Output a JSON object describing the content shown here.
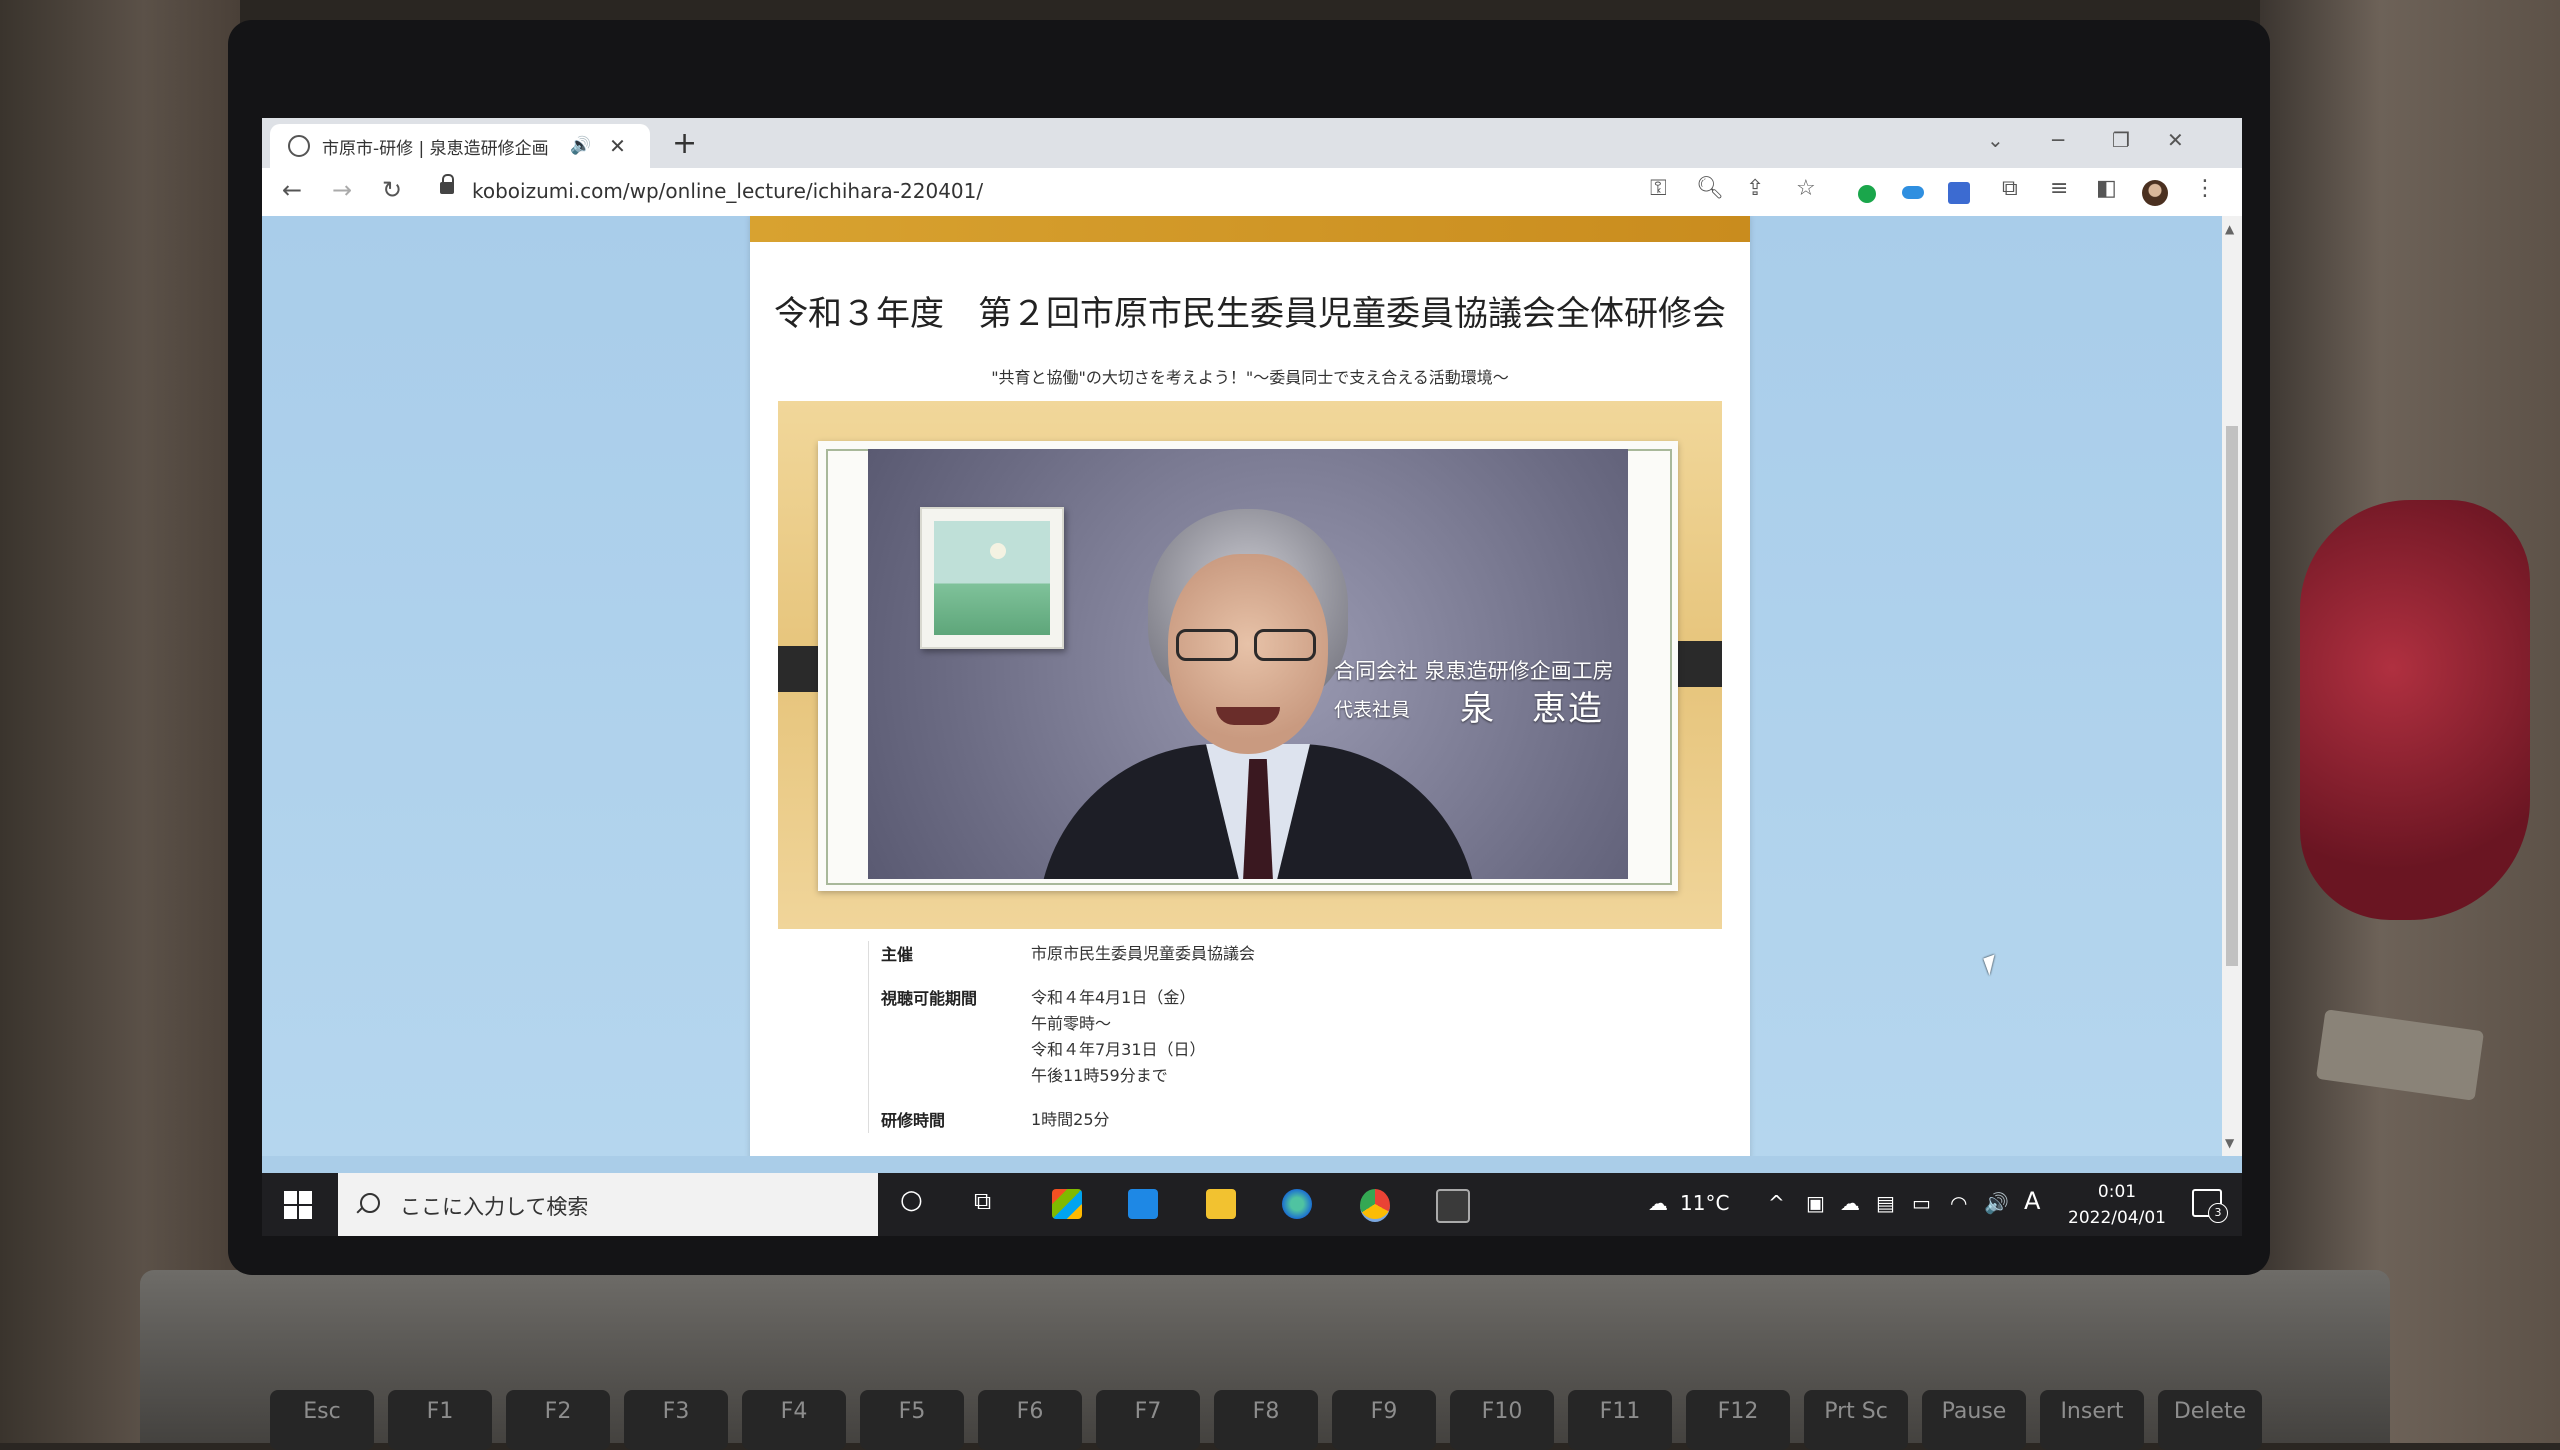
{
  "browser": {
    "tab_title": "市原市-研修 | 泉恵造研修企画",
    "new_tab": "+",
    "url": "koboizumi.com/wp/online_lecture/ichihara-220401/"
  },
  "page": {
    "heading": "令和３年度　第２回市原市民生委員児童委員協議会全体研修会",
    "subtitle": "\"共育と協働\"の大切さを考えよう！\"～委員同士で支え合える活動環境～",
    "video": {
      "company": "合同会社 泉恵造研修企画工房",
      "role": "代表社員",
      "name": "泉　恵造"
    },
    "info": [
      {
        "label": "主催",
        "lines": [
          "市原市民生委員児童委員協議会"
        ]
      },
      {
        "label": "視聴可能期間",
        "lines": [
          "令和４年4月1日（金）",
          "午前零時～",
          "令和４年7月31日（日）",
          "午後11時59分まで"
        ]
      },
      {
        "label": "研修時間",
        "lines": [
          "1時間25分"
        ]
      }
    ]
  },
  "taskbar": {
    "search_placeholder": "ここに入力して検索",
    "weather": "11°C",
    "ime": "A",
    "time": "0:01",
    "date": "2022/04/01",
    "notifications": "3"
  },
  "keyboard": [
    "Esc",
    "F1",
    "F2",
    "F3",
    "F4",
    "F5",
    "F6",
    "F7",
    "F8",
    "F9",
    "F10",
    "F11",
    "F12",
    "Prt Sc",
    "Pause",
    "Insert",
    "Delete"
  ],
  "colors": {
    "page_bg": "#aacde8",
    "card_band": "#d8a230",
    "frame_wood": "#e6c47b",
    "taskbar": "#1f1f22"
  }
}
